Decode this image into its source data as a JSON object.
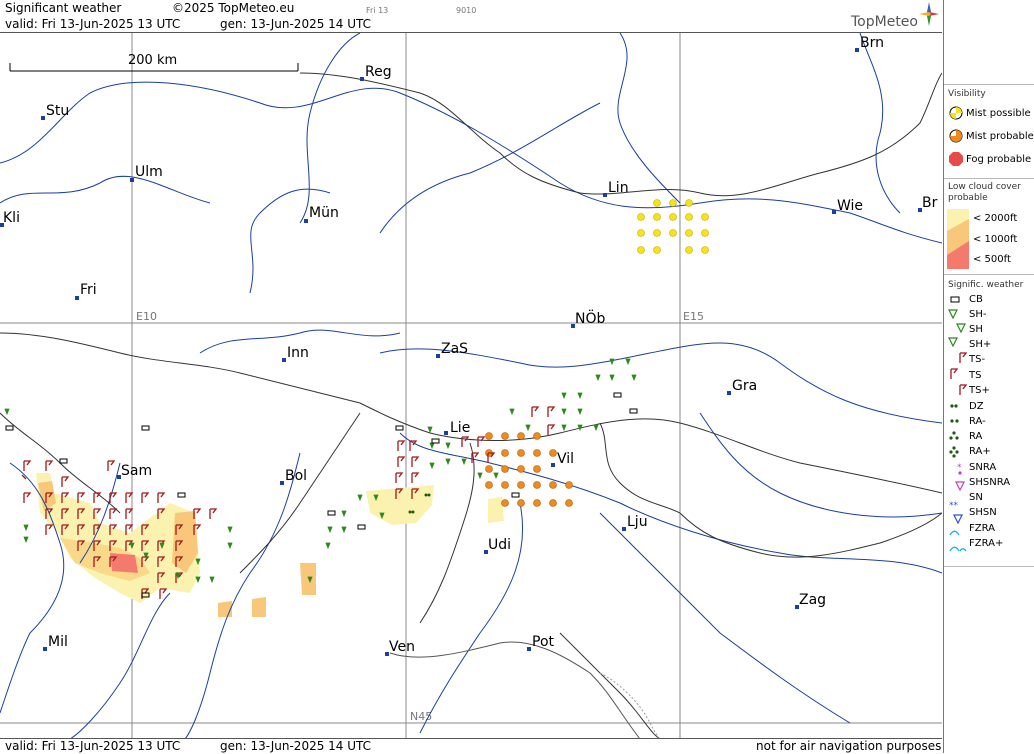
{
  "header": {
    "title": "Significant weather",
    "copyright": "©2025 TopMeteo.eu",
    "tab_day": "Fri 13",
    "code": "9010",
    "valid": "valid:  Fri  13-Jun-2025  13 UTC",
    "gen": "gen: 13-Jun-2025 14 UTC",
    "brand": "TopMeteo"
  },
  "footer": {
    "valid": "valid:  Fri  13-Jun-2025  13 UTC",
    "gen": "gen: 13-Jun-2025 14 UTC",
    "disclaimer": "not for air navigation purposes"
  },
  "map": {
    "scale_label": "200 km",
    "grid_labels": {
      "e10": "E10",
      "e15": "E15",
      "n45": "N45"
    },
    "cities": [
      {
        "name": "Brn"
      },
      {
        "name": "Reg"
      },
      {
        "name": "Stu"
      },
      {
        "name": "Ulm"
      },
      {
        "name": "Kli"
      },
      {
        "name": "Mün"
      },
      {
        "name": "Lin"
      },
      {
        "name": "Wie"
      },
      {
        "name": "Br"
      },
      {
        "name": "Fri"
      },
      {
        "name": "NÖb"
      },
      {
        "name": "Inn"
      },
      {
        "name": "ZaS"
      },
      {
        "name": "Gra"
      },
      {
        "name": "Lie"
      },
      {
        "name": "Vil"
      },
      {
        "name": "Sam"
      },
      {
        "name": "Bol"
      },
      {
        "name": "Lju"
      },
      {
        "name": "Udi"
      },
      {
        "name": "Zag"
      },
      {
        "name": "Mil"
      },
      {
        "name": "Ven"
      },
      {
        "name": "Pot"
      }
    ],
    "colors": {
      "river": "#1a3fa0",
      "border": "#333333",
      "grid": "#888888",
      "mist_possible": "#f7e21a",
      "mist_probable": "#f08a1a",
      "fog": "#e84a4a",
      "lowcloud_2000": "#fbf2b0",
      "lowcloud_1000": "#f9c77a",
      "lowcloud_500": "#f47a6e",
      "ts": "#a01818",
      "sh": "#2a8a1a"
    }
  },
  "legend": {
    "visibility": {
      "heading": "Visibility",
      "items": [
        {
          "label": "Mist possible",
          "icon": "mist-possible-icon"
        },
        {
          "label": "Mist probable",
          "icon": "mist-probable-icon"
        },
        {
          "label": "Fog probable",
          "icon": "fog-probable-icon"
        }
      ]
    },
    "lowcloud": {
      "heading1": "Low cloud cover",
      "heading2": "probable",
      "items": [
        {
          "label": "< 2000ft"
        },
        {
          "label": "< 1000ft"
        },
        {
          "label": "<   500ft"
        }
      ]
    },
    "signific": {
      "heading": "Signific. weather",
      "items": [
        {
          "label": "CB",
          "icon": "cb-icon"
        },
        {
          "label": "SH-",
          "icon": "shower-light-icon"
        },
        {
          "label": "SH",
          "icon": "shower-icon"
        },
        {
          "label": "SH+",
          "icon": "shower-heavy-icon"
        },
        {
          "label": "TS-",
          "icon": "thunderstorm-light-icon"
        },
        {
          "label": "TS",
          "icon": "thunderstorm-icon"
        },
        {
          "label": "TS+",
          "icon": "thunderstorm-heavy-icon"
        },
        {
          "label": "DZ",
          "icon": "drizzle-icon"
        },
        {
          "label": "RA-",
          "icon": "rain-light-icon"
        },
        {
          "label": "RA",
          "icon": "rain-icon"
        },
        {
          "label": "RA+",
          "icon": "rain-heavy-icon"
        },
        {
          "label": "SNRA",
          "icon": "snow-rain-icon"
        },
        {
          "label": "SHSNRA",
          "icon": "snow-rain-shower-icon"
        },
        {
          "label": "SN",
          "icon": "snow-icon"
        },
        {
          "label": "SHSN",
          "icon": "snow-shower-icon"
        },
        {
          "label": "FZRA",
          "icon": "freezing-rain-icon"
        },
        {
          "label": "FZRA+",
          "icon": "freezing-rain-heavy-icon"
        }
      ]
    }
  }
}
